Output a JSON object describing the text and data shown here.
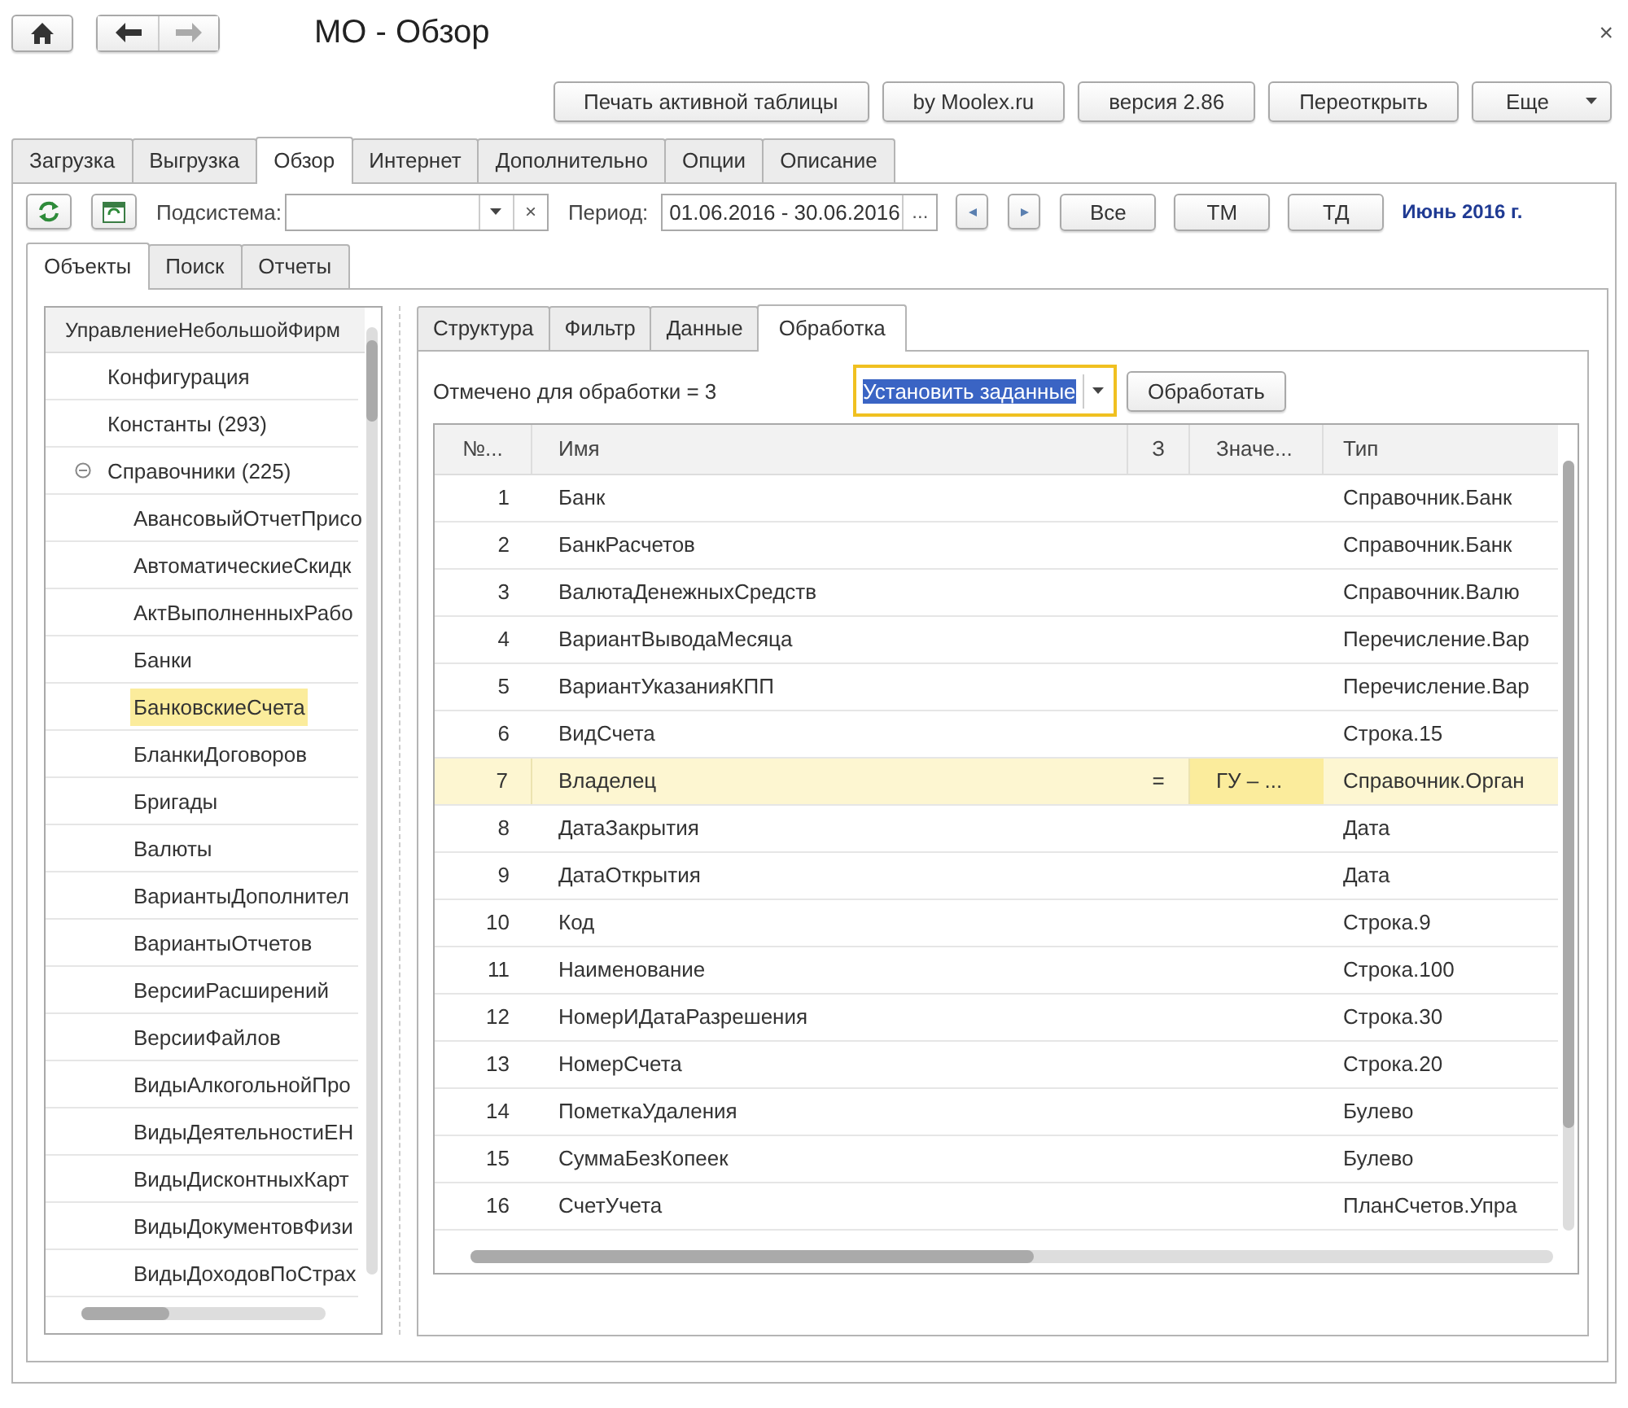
{
  "window": {
    "title": "МО - Обзор",
    "close": "×"
  },
  "commands": [
    {
      "label": "Печать активной таблицы",
      "kind": "button"
    },
    {
      "label": "by Moolex.ru",
      "kind": "button"
    },
    {
      "label": "версия 2.86",
      "kind": "button"
    },
    {
      "label": "Переоткрыть",
      "kind": "button"
    },
    {
      "label": "Еще",
      "kind": "menu"
    }
  ],
  "tabs": [
    {
      "label": "Загрузка",
      "selected": false
    },
    {
      "label": "Выгрузка",
      "selected": false
    },
    {
      "label": "Обзор",
      "selected": true
    },
    {
      "label": "Интернет",
      "selected": false
    },
    {
      "label": "Дополнительно",
      "selected": false
    },
    {
      "label": "Опции",
      "selected": false
    },
    {
      "label": "Описание",
      "selected": false
    }
  ],
  "toolbar": {
    "subsystem_label": "Подсистема:",
    "clear": "×",
    "period_label": "Период:",
    "period": "01.06.2016 - 30.06.2016",
    "choose": "...",
    "quick_buttons": [
      "Все",
      "ТМ",
      "ТД"
    ],
    "period_text": "Июнь 2016 г."
  },
  "object_tabs": [
    {
      "label": "Объекты",
      "selected": true
    },
    {
      "label": "Поиск",
      "selected": false
    },
    {
      "label": "Отчеты",
      "selected": false
    }
  ],
  "tree": {
    "header": "УправлениеНебольшойФирм",
    "items": [
      {
        "label": "Конфигурация",
        "selected": false
      },
      {
        "label": "Константы (293)",
        "selected": false
      },
      {
        "label": "Справочники (225)",
        "selected": false,
        "expanded": true,
        "children": [
          {
            "label": "АвансовыйОтчетПрисо",
            "selected": false
          },
          {
            "label": "АвтоматическиеСкидк",
            "selected": false
          },
          {
            "label": "АктВыполненныхРабо",
            "selected": false
          },
          {
            "label": "Банки",
            "selected": false
          },
          {
            "label": "БанковскиеСчета",
            "selected": true
          },
          {
            "label": "БланкиДоговоров",
            "selected": false
          },
          {
            "label": "Бригады",
            "selected": false
          },
          {
            "label": "Валюты",
            "selected": false
          },
          {
            "label": "ВариантыДополнител",
            "selected": false
          },
          {
            "label": "ВариантыОтчетов",
            "selected": false
          },
          {
            "label": "ВерсииРасширений",
            "selected": false
          },
          {
            "label": "ВерсииФайлов",
            "selected": false
          },
          {
            "label": "ВидыАлкогольнойПро",
            "selected": false
          },
          {
            "label": "ВидыДеятельностиЕН",
            "selected": false
          },
          {
            "label": "ВидыДисконтныхКарт",
            "selected": false
          },
          {
            "label": "ВидыДокументовФизи",
            "selected": false
          },
          {
            "label": "ВидыДоходовПоСтрах",
            "selected": false
          }
        ]
      }
    ]
  },
  "data_tabs": [
    {
      "label": "Структура",
      "selected": false
    },
    {
      "label": "Фильтр",
      "selected": false
    },
    {
      "label": "Данные",
      "selected": false
    },
    {
      "label": "Обработка",
      "selected": true
    }
  ],
  "processing": {
    "marked": "Отмечено для обработки = 3",
    "action": "Установить заданные",
    "run": "Обработать"
  },
  "table": {
    "columns": [
      "№...",
      "Имя",
      "З",
      "Значе...",
      "Тип"
    ],
    "rows": [
      {
        "cells": [
          "1",
          "Банк",
          "",
          "",
          "Справочник.Банк"
        ],
        "selected": false
      },
      {
        "cells": [
          "2",
          "БанкРасчетов",
          "",
          "",
          "Справочник.Банк"
        ],
        "selected": false
      },
      {
        "cells": [
          "3",
          "ВалютаДенежныхСредств",
          "",
          "",
          "Справочник.Валю"
        ],
        "selected": false
      },
      {
        "cells": [
          "4",
          "ВариантВыводаМесяца",
          "",
          "",
          "Перечисление.Вар"
        ],
        "selected": false
      },
      {
        "cells": [
          "5",
          "ВариантУказанияКПП",
          "",
          "",
          "Перечисление.Вар"
        ],
        "selected": false
      },
      {
        "cells": [
          "6",
          "ВидСчета",
          "",
          "",
          "Строка.15"
        ],
        "selected": false
      },
      {
        "cells": [
          "7",
          "Владелец",
          "=",
          "ГУ – ...",
          "Справочник.Орган"
        ],
        "selected": true
      },
      {
        "cells": [
          "8",
          "ДатаЗакрытия",
          "",
          "",
          "Дата"
        ],
        "selected": false
      },
      {
        "cells": [
          "9",
          "ДатаОткрытия",
          "",
          "",
          "Дата"
        ],
        "selected": false
      },
      {
        "cells": [
          "10",
          "Код",
          "",
          "",
          "Строка.9"
        ],
        "selected": false
      },
      {
        "cells": [
          "11",
          "Наименование",
          "",
          "",
          "Строка.100"
        ],
        "selected": false
      },
      {
        "cells": [
          "12",
          "НомерИДатаРазрешения",
          "",
          "",
          "Строка.30"
        ],
        "selected": false
      },
      {
        "cells": [
          "13",
          "НомерСчета",
          "",
          "",
          "Строка.20"
        ],
        "selected": false
      },
      {
        "cells": [
          "14",
          "ПометкаУдаления",
          "",
          "",
          "Булево"
        ],
        "selected": false
      },
      {
        "cells": [
          "15",
          "СуммаБезКопеек",
          "",
          "",
          "Булево"
        ],
        "selected": false
      },
      {
        "cells": [
          "16",
          "СчетУчета",
          "",
          "",
          "ПланСчетов.Упра"
        ],
        "selected": false
      }
    ]
  }
}
